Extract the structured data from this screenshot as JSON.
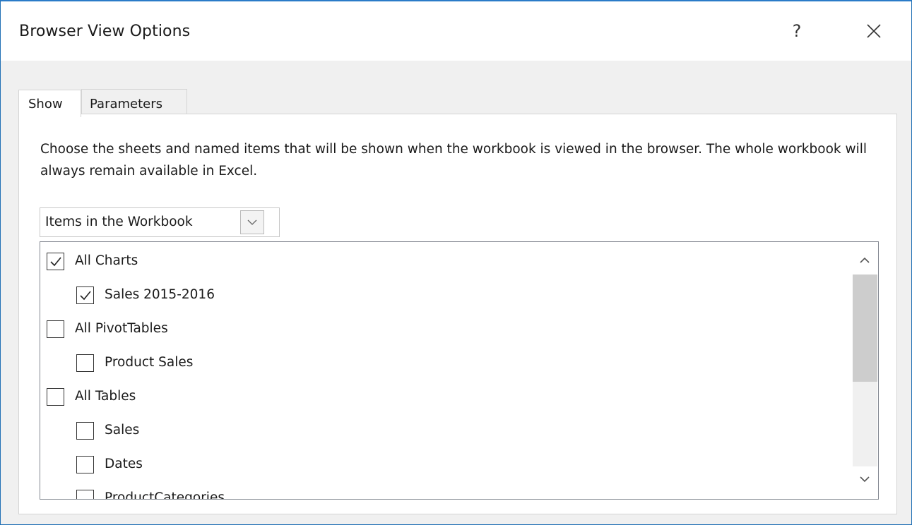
{
  "dialog": {
    "title": "Browser View Options",
    "help_label": "?",
    "close_icon": "close-icon"
  },
  "tabs": [
    {
      "label": "Show",
      "active": true
    },
    {
      "label": "Parameters",
      "active": false
    }
  ],
  "show_tab": {
    "description": "Choose the sheets and named items that will be shown when the workbook is viewed in the browser. The whole workbook will always remain available in Excel.",
    "dropdown": {
      "selected": "Items in the Workbook",
      "icon": "chevron-down-icon"
    },
    "items": [
      {
        "label": "All Charts",
        "checked": true,
        "level": 0
      },
      {
        "label": "Sales 2015-2016",
        "checked": true,
        "level": 1
      },
      {
        "label": "All PivotTables",
        "checked": false,
        "level": 0
      },
      {
        "label": "Product Sales",
        "checked": false,
        "level": 1
      },
      {
        "label": "All Tables",
        "checked": false,
        "level": 0
      },
      {
        "label": "Sales",
        "checked": false,
        "level": 1
      },
      {
        "label": "Dates",
        "checked": false,
        "level": 1
      },
      {
        "label": "ProductCategories",
        "checked": false,
        "level": 1
      }
    ]
  },
  "colors": {
    "window_border": "#2a7bc8",
    "dialog_background": "#f0f0f0",
    "panel_background": "#ffffff",
    "scroll_thumb": "#cdcdcd"
  }
}
